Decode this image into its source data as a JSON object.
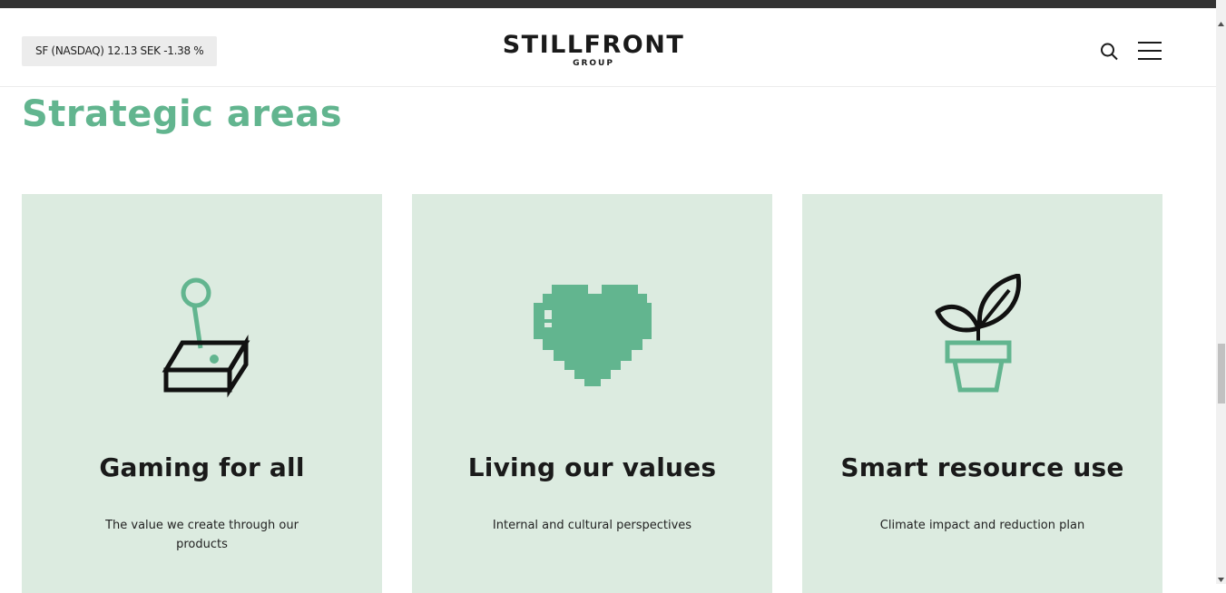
{
  "header": {
    "ticker_text": "SF (NASDAQ) 12.13 SEK -1.38 %",
    "logo_main": "STILLFRONT",
    "logo_sub": "GROUP",
    "search_icon": "search-icon",
    "menu_icon": "hamburger-menu-icon"
  },
  "section": {
    "title": "Strategic areas"
  },
  "cards": [
    {
      "title": "Gaming for all",
      "description": "The value we create through our products",
      "icon": "joystick-icon"
    },
    {
      "title": "Living our values",
      "description": "Internal and cultural perspectives",
      "icon": "pixel-heart-icon"
    },
    {
      "title": "Smart resource use",
      "description": "Climate impact and reduction plan",
      "icon": "plant-pot-icon"
    }
  ],
  "colors": {
    "accent_green": "#62b58f",
    "card_background": "#dcebe0",
    "text_dark": "#1a1a1a",
    "top_bar": "#333333"
  }
}
